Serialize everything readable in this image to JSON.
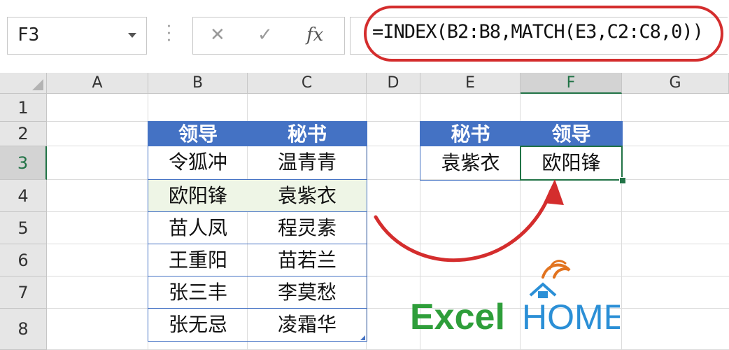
{
  "formula_bar": {
    "name_box": "F3",
    "cancel_icon": "✕",
    "enter_icon": "✓",
    "fx_label": "fx",
    "formula": "=INDEX(B2:B8,MATCH(E3,C2:C8,0))"
  },
  "columns": [
    "A",
    "B",
    "C",
    "D",
    "E",
    "F",
    "G"
  ],
  "rows": [
    "1",
    "2",
    "3",
    "4",
    "5",
    "6",
    "7",
    "8"
  ],
  "selected": {
    "column": "F",
    "row": "3"
  },
  "table": {
    "headers": [
      "领导",
      "秘书"
    ],
    "rows": [
      [
        "令狐冲",
        "温青青"
      ],
      [
        "欧阳锋",
        "袁紫衣"
      ],
      [
        "苗人凤",
        "程灵素"
      ],
      [
        "王重阳",
        "苗若兰"
      ],
      [
        "张三丰",
        "李莫愁"
      ],
      [
        "张无忌",
        "凌霜华"
      ]
    ]
  },
  "lookup": {
    "headers": [
      "秘书",
      "领导"
    ],
    "input": "袁紫衣",
    "result": "欧阳锋"
  },
  "logo": {
    "text_green": "Excel",
    "text_blue": "HOME"
  },
  "colors": {
    "table_header": "#4472c4",
    "active_cell": "#217346",
    "annotation": "#d42d2d",
    "logo_green": "#2e9e3a",
    "logo_blue": "#2b8fd6",
    "logo_orange": "#e2731f"
  }
}
